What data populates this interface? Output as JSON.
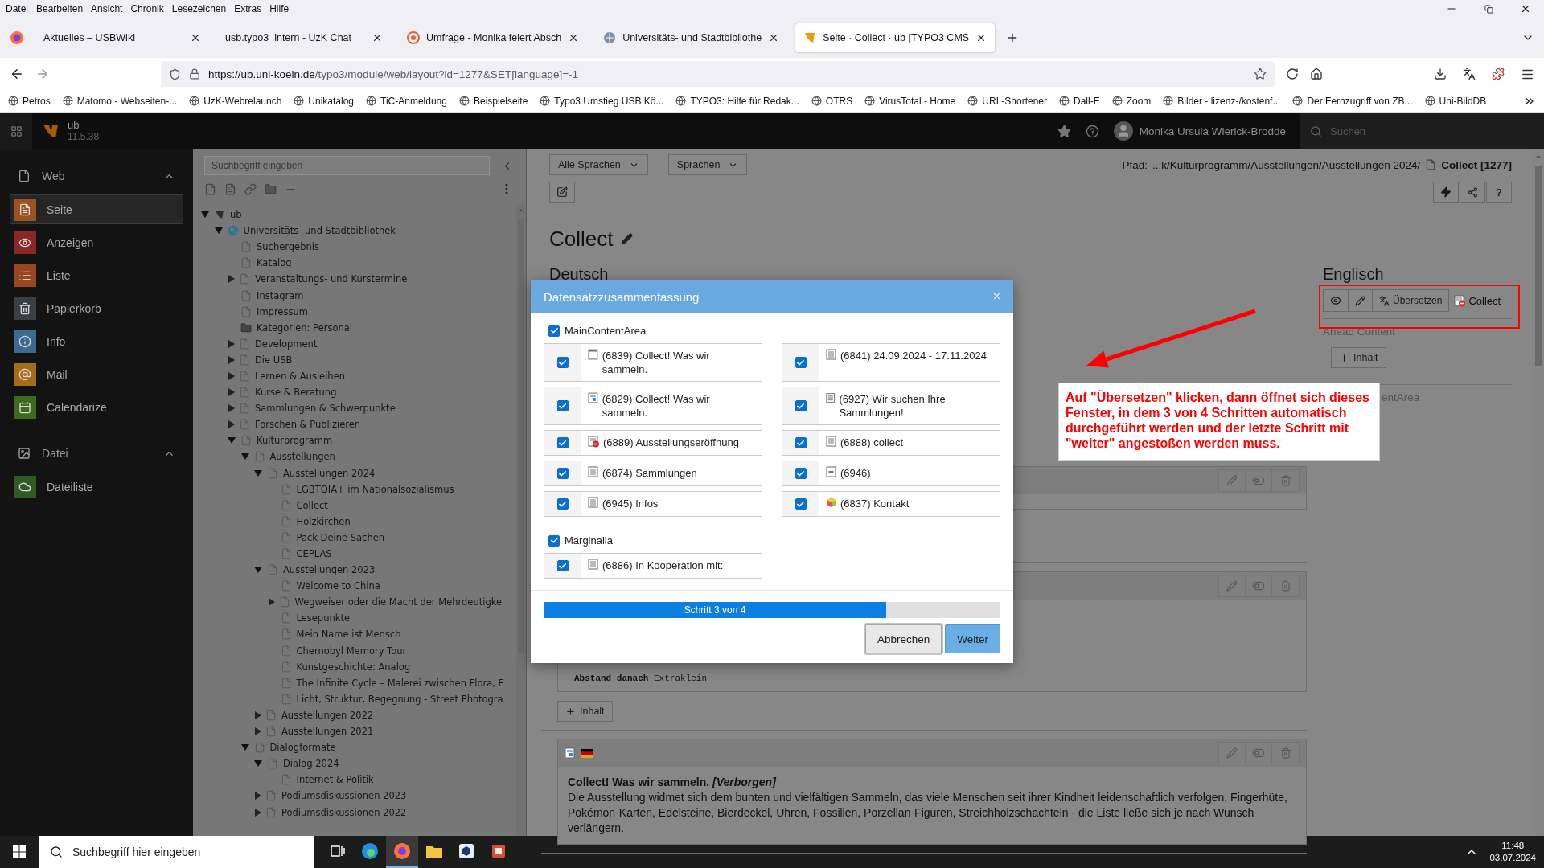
{
  "browser": {
    "menu": [
      "Datei",
      "Bearbeiten",
      "Ansicht",
      "Chronik",
      "Lesezeichen",
      "Extras",
      "Hilfe"
    ],
    "tabs": [
      {
        "title": "Aktuelles – USBWiki",
        "kind": "none",
        "selected": false
      },
      {
        "title": "usb.typo3_intern - UzK Chat",
        "kind": "none",
        "selected": false
      },
      {
        "title": "Umfrage - Monika feiert Absch",
        "kind": "poll",
        "selected": false
      },
      {
        "title": "Universitäts- und Stadtbibliothe",
        "kind": "globe",
        "selected": false
      },
      {
        "title": "Seite · Collect · ub [TYPO3 CMS",
        "kind": "cms",
        "selected": true
      }
    ],
    "url_host": "https://ub.uni-koeln.de",
    "url_path": "/typo3/module/web/layout?id=1277&SET[language]=-1",
    "bookmarks": [
      "Petros",
      "Matomo - Webseiten-...",
      "UzK-Webrelaunch",
      "Unikatalog",
      "TiC-Anmeldung",
      "Beispielseite",
      "Typo3 Umstieg USB Kö...",
      "TYPO3: Hilfe für Redak...",
      "OTRS",
      "VirusTotal - Home",
      "URL-Shortener",
      "Dall-E",
      "Zoom",
      "Bilder - lizenz-/kostenf...",
      "Der Fernzugriff von ZB...",
      "Uni-BildDB"
    ]
  },
  "typo3": {
    "site": "ub",
    "version": "11.5.38",
    "user": "Monika Ursula Wierick-Brodde",
    "search_placeholder": "Suchen"
  },
  "modules": [
    {
      "label": "Web",
      "kind": "page",
      "expanded": true,
      "items": [
        {
          "label": "Seite",
          "kind": "page",
          "selected": true
        },
        {
          "label": "Anzeigen",
          "kind": "view",
          "selected": false
        },
        {
          "label": "Liste",
          "kind": "list",
          "selected": false
        },
        {
          "label": "Papierkorb",
          "kind": "trash",
          "selected": false
        },
        {
          "label": "Info",
          "kind": "info",
          "selected": false
        },
        {
          "label": "Mail",
          "kind": "mail",
          "selected": false
        },
        {
          "label": "Calendarize",
          "kind": "calendar",
          "selected": false
        }
      ]
    },
    {
      "label": "Datei",
      "kind": "image",
      "expanded": true,
      "items": [
        {
          "label": "Dateiliste",
          "kind": "files",
          "selected": false
        }
      ]
    }
  ],
  "page_tree": {
    "search_placeholder": "Suchbegriff eingeben",
    "nodes": [
      {
        "label": "ub",
        "kind": "root",
        "expanded": true,
        "children": [
          {
            "label": "Universitäts- und Stadtbibliothek",
            "kind": "globe",
            "expanded": true,
            "children": [
              {
                "label": "Suchergebnis",
                "kind": "page"
              },
              {
                "label": "Katalog",
                "kind": "page"
              },
              {
                "label": "Veranstaltungs- und Kurstermine",
                "kind": "page",
                "expanded": false
              },
              {
                "label": "Instagram",
                "kind": "page"
              },
              {
                "label": "Impressum",
                "kind": "page"
              },
              {
                "label": "Kategorien: Personal",
                "kind": "folder"
              },
              {
                "label": "Development",
                "kind": "page",
                "expanded": false
              },
              {
                "label": "Die USB",
                "kind": "page",
                "expanded": false
              },
              {
                "label": "Lernen & Ausleihen",
                "kind": "page",
                "expanded": false
              },
              {
                "label": "Kurse & Beratung",
                "kind": "page",
                "expanded": false
              },
              {
                "label": "Sammlungen & Schwerpunkte",
                "kind": "page",
                "expanded": false
              },
              {
                "label": "Forschen & Publizieren",
                "kind": "page",
                "expanded": false
              },
              {
                "label": "Kulturprogramm",
                "kind": "page",
                "expanded": true,
                "children": [
                  {
                    "label": "Ausstellungen",
                    "kind": "page",
                    "expanded": true,
                    "children": [
                      {
                        "label": "Ausstellungen 2024",
                        "kind": "page",
                        "expanded": true,
                        "children": [
                          {
                            "label": "LGBTQIA+ im Nationalsozialismus",
                            "kind": "page"
                          },
                          {
                            "label": "Collect",
                            "kind": "page"
                          },
                          {
                            "label": "Holzkirchen",
                            "kind": "page"
                          },
                          {
                            "label": "Pack Deine Sachen",
                            "kind": "page"
                          },
                          {
                            "label": "CEPLAS",
                            "kind": "page"
                          }
                        ]
                      },
                      {
                        "label": "Ausstellungen 2023",
                        "kind": "page",
                        "expanded": true,
                        "children": [
                          {
                            "label": "Welcome to China",
                            "kind": "page"
                          },
                          {
                            "label": "Wegweiser oder die Macht der Mehrdeutigke",
                            "kind": "page",
                            "expanded": false
                          },
                          {
                            "label": "Lesepunkte",
                            "kind": "page"
                          },
                          {
                            "label": "Mein Name ist Mensch",
                            "kind": "page"
                          },
                          {
                            "label": "Chernobyl Memory Tour",
                            "kind": "page"
                          },
                          {
                            "label": "Kunstgeschichte: Analog",
                            "kind": "page"
                          },
                          {
                            "label": "The Infinite Cycle – Malerei zwischen Flora, F",
                            "kind": "page"
                          },
                          {
                            "label": "Licht, Struktur, Begegnung - Street Photogra",
                            "kind": "page"
                          }
                        ]
                      },
                      {
                        "label": "Ausstellungen 2022",
                        "kind": "page",
                        "expanded": false
                      },
                      {
                        "label": "Ausstellungen 2021",
                        "kind": "page",
                        "expanded": false
                      }
                    ]
                  },
                  {
                    "label": "Dialogformate",
                    "kind": "page",
                    "expanded": true,
                    "children": [
                      {
                        "label": "Dialog 2024",
                        "kind": "page",
                        "expanded": true,
                        "children": [
                          {
                            "label": "Internet & Politik",
                            "kind": "page"
                          }
                        ]
                      },
                      {
                        "label": "Podiumsdiskussionen 2023",
                        "kind": "page",
                        "expanded": false
                      },
                      {
                        "label": "Podiumsdiskussionen 2022",
                        "kind": "page",
                        "expanded": false
                      }
                    ]
                  }
                ]
              }
            ]
          }
        ]
      }
    ]
  },
  "doc_header": {
    "language_select": "Alle Sprachen",
    "languages_button": "Sprachen",
    "path_label": "Pfad:",
    "path": "...k/Kulturprogramm/Ausstellungen/Ausstellungen 2024/",
    "page": "Collect [1277]",
    "help_button": "?"
  },
  "page": {
    "title": "Collect",
    "deutsch": {
      "heading": "Deutsch",
      "rows": [
        {
          "elements": [
            {
              "kind": "plain"
            }
          ]
        },
        {
          "elements": [
            {
              "kind": "spacing",
              "text": "**Abstand danach** Extraklein"
            }
          ],
          "add_button": "Inhalt"
        },
        {
          "elements": [
            {
              "kind": "text",
              "title": "Collect! Was wir sammeln. *[Verborgen]*",
              "body": "Die Ausstellung widmet sich dem bunten und vielfältigen Sammeln, das viele Menschen seit ihrer Kindheit leidenschaftlich verfolgen. Fingerhüte, Pokémon-Karten, Edelsteine, Bierdeckel, Uhren, Fossilien, Porzellan-Figuren, Streichholzschachteln - die Liste ließe sich je nach Wunsch verlängern."
            }
          ]
        }
      ]
    },
    "englisch": {
      "heading": "Englisch",
      "translate_button": "Übersetzen",
      "page_label": "Collect",
      "ahead_label": "Ahead Content",
      "add_button": "Inhalt",
      "column_label": "entArea"
    }
  },
  "modal": {
    "title": "Datensatzzusammenfassung",
    "close": "×",
    "sections": [
      {
        "label": "MainContentArea",
        "checked": true,
        "records": [
          {
            "label": "(6839) Collect! Was wir sammeln.",
            "kind": "header",
            "checked": true
          },
          {
            "label": "(6841) 24.09.2024 - 17.11.2024",
            "kind": "text",
            "checked": true
          },
          {
            "label": "(6829) Collect! Was wir sammeln.",
            "kind": "textmedia",
            "checked": true
          },
          {
            "label": "(6927) Wir suchen Ihre Sammlungen!",
            "kind": "text",
            "checked": true
          },
          {
            "label": "(6889) Ausstellungseröffnung",
            "kind": "hidden",
            "checked": true
          },
          {
            "label": "(6888) collect",
            "kind": "text",
            "checked": true
          },
          {
            "label": "(6874) Sammlungen",
            "kind": "text",
            "checked": true
          },
          {
            "label": "(6946)",
            "kind": "divider",
            "checked": true
          },
          {
            "label": "(6945) Infos",
            "kind": "text",
            "checked": true
          },
          {
            "label": "(6837) Kontakt",
            "kind": "plugin",
            "checked": true
          }
        ]
      },
      {
        "label": "Marginalia",
        "checked": true,
        "records": [
          {
            "label": "(6886) In Kooperation mit:",
            "kind": "text",
            "checked": true
          }
        ]
      }
    ],
    "progress": {
      "label": "Schritt 3 von 4",
      "level": 0.75
    },
    "buttons": [
      {
        "label": "Abbrechen",
        "kind": "secondary"
      },
      {
        "label": "Weiter",
        "kind": "primary"
      }
    ]
  },
  "annotation": {
    "text": "Auf \"Übersetzen\" klicken, dann öffnet sich dieses Fenster, in dem 3 von 4 Schritten automatisch durchgeführt werden und der letzte Schritt mit \"weiter\" angestoßen werden muss."
  },
  "taskbar": {
    "search_placeholder": "Suchbegriff hier eingeben",
    "time": "11:48",
    "date": "03.07.2024"
  }
}
